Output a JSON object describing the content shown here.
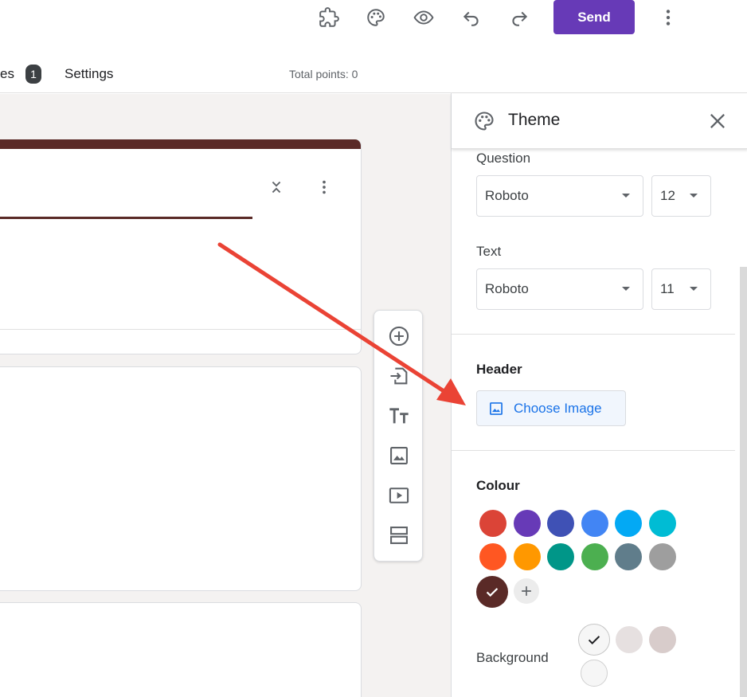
{
  "toolbar": {
    "send_label": "Send"
  },
  "tabs": {
    "partial_label": "es",
    "badge_count": "1",
    "settings_label": "Settings"
  },
  "total_points": "Total points: 0",
  "panel": {
    "title": "Theme",
    "question": {
      "label": "Question",
      "font": "Roboto",
      "size": "12"
    },
    "text": {
      "label": "Text",
      "font": "Roboto",
      "size": "11"
    },
    "header": {
      "title": "Header",
      "button_label": "Choose Image"
    },
    "colour": {
      "title": "Colour",
      "swatches": [
        "#db4437",
        "#673ab7",
        "#3f51b5",
        "#4285f4",
        "#03a9f4",
        "#00bcd4",
        "#ff5722",
        "#ff9800",
        "#009688",
        "#4caf50",
        "#607d8b",
        "#9e9e9e"
      ],
      "selected": "#5a2a27"
    },
    "background": {
      "label": "Background",
      "swatches": [
        "#f6f6f6",
        "#e6e0e0",
        "#d8cccb",
        "#f6f6f6"
      ]
    }
  },
  "colors": {
    "accent": "#673ab7",
    "theme": "#5a2a27",
    "link": "#1a73e8",
    "annotation_arrow": "#ea4335"
  }
}
